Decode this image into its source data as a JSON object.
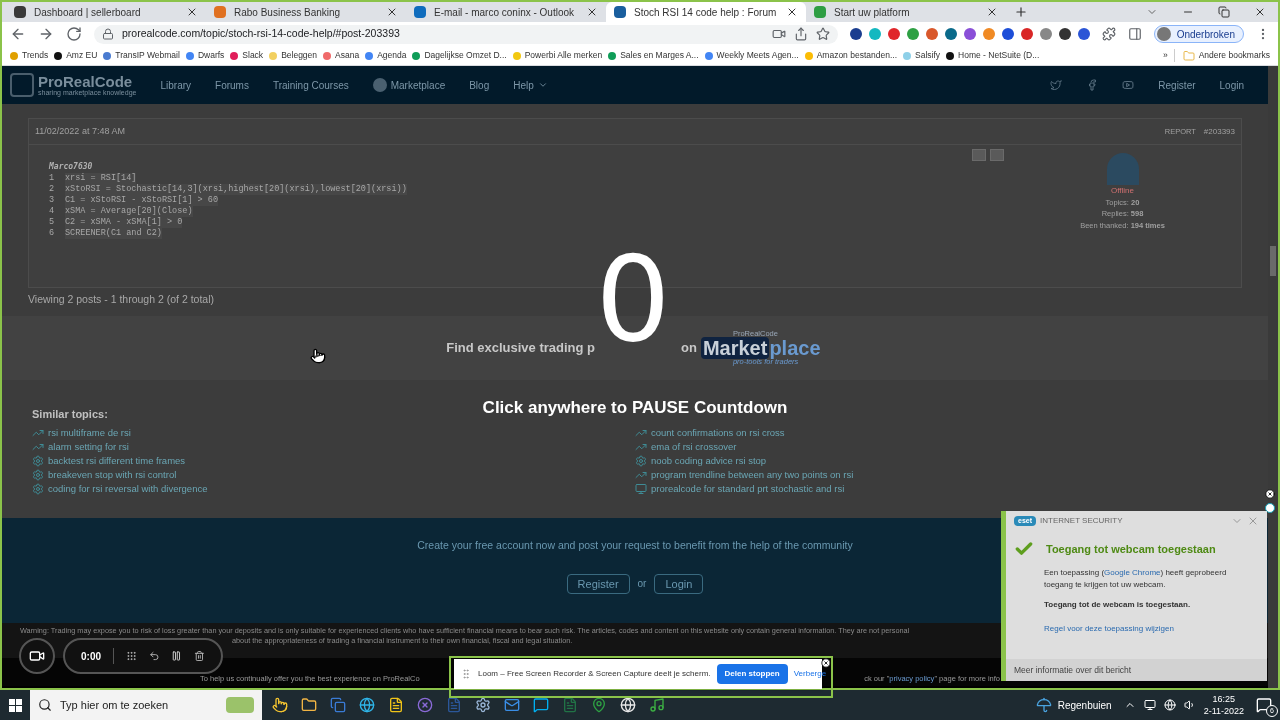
{
  "browser": {
    "tabs": [
      {
        "title": "Dashboard | sellerboard",
        "color": "#3a3a3a",
        "selected": false
      },
      {
        "title": "Rabo Business Banking",
        "color": "#e07020",
        "selected": false
      },
      {
        "title": "E-mail - marco coninx - Outlook",
        "color": "#0f6cbd",
        "selected": false
      },
      {
        "title": "Stoch RSI 14 code help : Forum",
        "color": "#1a5f9e",
        "selected": true
      },
      {
        "title": "Start uw platform",
        "color": "#2e9e44",
        "selected": false
      }
    ],
    "url": "prorealcode.com/topic/stoch-rsi-14-code-help/#post-203393",
    "profile": "Onderbroken",
    "bookmarks": [
      {
        "label": "Trends",
        "color": "#e0a000"
      },
      {
        "label": "Amz EU",
        "color": "#111111"
      },
      {
        "label": "TransIP Webmail",
        "color": "#4a7bd0"
      },
      {
        "label": "Dwarfs",
        "color": "#4285f4"
      },
      {
        "label": "Slack",
        "color": "#e01e5a"
      },
      {
        "label": "Beleggen",
        "color": "#f2d060"
      },
      {
        "label": "Asana",
        "color": "#f06a6a"
      },
      {
        "label": "Agenda",
        "color": "#4285f4"
      },
      {
        "label": "Dagelijkse Omzet D...",
        "color": "#0f9d58"
      },
      {
        "label": "Powerbi Alle merken",
        "color": "#f2c811"
      },
      {
        "label": "Sales en Marges A...",
        "color": "#0f9d58"
      },
      {
        "label": "Weekly Meets Agen...",
        "color": "#4285f4"
      },
      {
        "label": "Amazon bestanden...",
        "color": "#fbbc04"
      },
      {
        "label": "Salsify",
        "color": "#8ed0e8"
      },
      {
        "label": "Home - NetSuite (D...",
        "color": "#111111"
      }
    ],
    "more_bookmarks": "»",
    "other_bookmarks": "Andere bookmarks"
  },
  "site": {
    "logo": "ProRealCode",
    "tagline": "sharing marketplace knowledge",
    "nav": [
      {
        "label": "Library",
        "kind": "link"
      },
      {
        "label": "Forums",
        "kind": "link"
      },
      {
        "label": "Training Courses",
        "kind": "link"
      },
      {
        "label": "Marketplace",
        "kind": "market"
      },
      {
        "label": "Blog",
        "kind": "link"
      },
      {
        "label": "Help",
        "kind": "menu"
      }
    ],
    "register": "Register",
    "login": "Login"
  },
  "post": {
    "date": "11/02/2022 at 7:48 AM",
    "report": "REPORT",
    "id": "#203393",
    "author": "Marco7630",
    "code": [
      {
        "number": "1",
        "text": "xrsi = RSI[14]"
      },
      {
        "number": "2",
        "text": "xStoRSI = Stochastic[14,3](xrsi,highest[20](xrsi),lowest[20](xrsi))"
      },
      {
        "number": "3",
        "text": "C1 = xStoRSI - xStoRSI[1] > 60"
      },
      {
        "number": "4",
        "text": "xSMA = Average[20](Close)"
      },
      {
        "number": "5",
        "text": "C2 = xSMA - xSMA[1] > 0"
      },
      {
        "number": "6",
        "text": "SCREENER(C1 and C2)"
      }
    ],
    "user_status": "Offline",
    "stats": [
      "Topics: **20**",
      "Replies: **598**",
      "Been thanked: **194 times**"
    ]
  },
  "viewing": "Viewing 2 posts - 1 through 2 (of 2 total)",
  "promo": {
    "text_before": "Find exclusive trading p",
    "text_after": "on",
    "logo_top": "ProRealCode",
    "logo_market": "Market",
    "logo_place": "place",
    "logo_sub": "pro-tools for traders"
  },
  "countdown": {
    "number": "0",
    "hint": "Click anywhere to PAUSE Countdown"
  },
  "similar": {
    "title": "Similar topics:",
    "items": [
      {
        "label": "rsi multiframe de rsi",
        "kind": "trend"
      },
      {
        "label": "alarm setting for rsi",
        "kind": "trend"
      },
      {
        "label": "backtest rsi different time frames",
        "kind": "gear"
      },
      {
        "label": "breakeven stop with rsi control",
        "kind": "gear"
      },
      {
        "label": "coding for rsi reversal with divergence",
        "kind": "gear"
      },
      {
        "label": "count confirmations on rsi cross",
        "kind": "trend"
      },
      {
        "label": "ema of rsi crossover",
        "kind": "trend"
      },
      {
        "label": "noob coding advice rsi stop",
        "kind": "gear"
      },
      {
        "label": "program trendline between any two points on rsi",
        "kind": "trend"
      },
      {
        "label": "prorealcode for standard prt stochastic and rsi",
        "kind": "screen"
      }
    ]
  },
  "signup": {
    "text": "Create your free account now and post your request to benefit from the help of the community",
    "register": "Register",
    "or": "or",
    "login": "Login"
  },
  "warning": [
    "Warning: Trading may expose you to risk of loss greater than your deposits and is only suitable for experienced clients who have sufficient financial means to bear such risk. The articles, codes and content on this website only contain general information. They are not personal",
    "about the appropriateness of trading a financial instrument to their own financial, fiscal and legal situation."
  ],
  "cookie": {
    "text_before": "To help us continually offer you the best experience on ProRealCo",
    "text_after": "ck our \"",
    "link": "privacy policy",
    "text_end": "\" page for more info"
  },
  "loom": {
    "timer": "0:00",
    "message": "Loom – Free Screen Recorder & Screen Capture deelt je scherm.",
    "stop": "Delen stoppen",
    "hide": "Verberge"
  },
  "eset": {
    "logo": "eset",
    "product": "INTERNET SECURITY",
    "title": "Toegang tot webcam toegestaan",
    "body_before": "Een toepassing (",
    "app": "Google Chrome",
    "body_after": ") heeft geprobeerd toegang te krijgen tot uw webcam.",
    "bold": "Toegang tot de webcam is toegestaan.",
    "rule_link": "Regel voor deze toepassing wijzigen",
    "more": "Meer informatie over dit bericht"
  },
  "taskbar": {
    "search": "Typ hier om te zoeken",
    "weather": "Regenbuien",
    "time": "16:25",
    "date": "2-11-2022",
    "notifications": "6"
  }
}
